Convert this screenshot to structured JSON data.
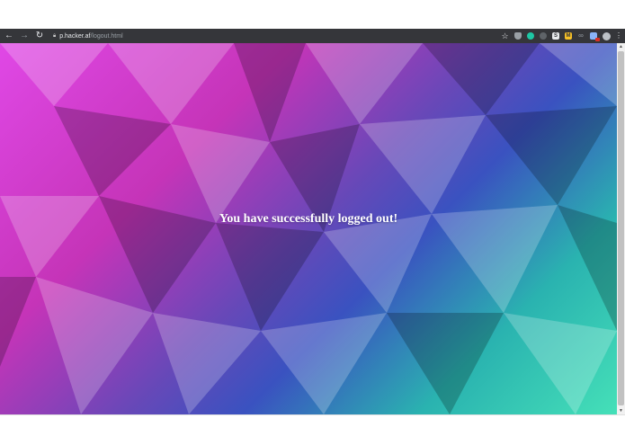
{
  "browser": {
    "url_host": "p.hacker.af",
    "url_path": "/logout.html",
    "back_icon": "arrow-left-icon",
    "forward_icon": "arrow-right-icon",
    "reload_icon": "reload-icon",
    "extensions": [
      "shield-icon",
      "teal-circle-icon",
      "grey-circle-icon",
      "s-extension-icon",
      "m-extension-icon",
      "link-icon",
      "puzzle-extension-icon"
    ],
    "extension_letters": {
      "s": "S",
      "m": "M"
    }
  },
  "page": {
    "message": "You have successfully logged out!",
    "colors": {
      "magenta": "#e048e6",
      "purple": "#6848b8",
      "blue": "#3a52c0",
      "teal": "#2ab3b0",
      "mint": "#45e0b8"
    }
  }
}
